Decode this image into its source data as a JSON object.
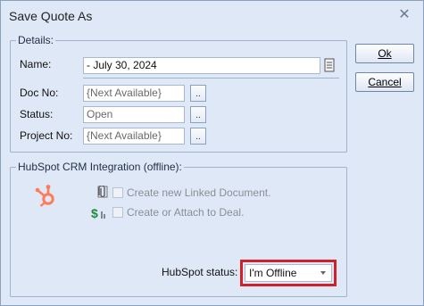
{
  "window": {
    "title": "Save Quote As",
    "close_symbol": "✕"
  },
  "details": {
    "legend": "Details:",
    "name_label": "Name:",
    "name_value": "- July 30, 2024",
    "doc_no_label": "Doc No:",
    "doc_no_value": "{Next Available}",
    "status_label": "Status:",
    "status_value": "Open",
    "project_no_label": "Project No:",
    "project_no_value": "{Next Available}",
    "browse_label": ".."
  },
  "hubspot": {
    "legend": "HubSpot CRM Integration (offline):",
    "create_linked_doc_label": "Create new Linked Document.",
    "attach_deal_label": "Create or Attach to Deal.",
    "status_label": "HubSpot status:",
    "status_value": "I'm Offline",
    "accent_color": "#ff7a59",
    "deal_icon_color": "#1f8a3a",
    "highlight_color": "#d0202a"
  },
  "buttons": {
    "ok_label": "Ok",
    "cancel_label": "Cancel"
  },
  "icons": [
    "close-icon",
    "notes-icon",
    "hubspot-logo-icon",
    "paperclip-icon",
    "deal-dollar-icon",
    "dropdown-arrow-icon"
  ]
}
